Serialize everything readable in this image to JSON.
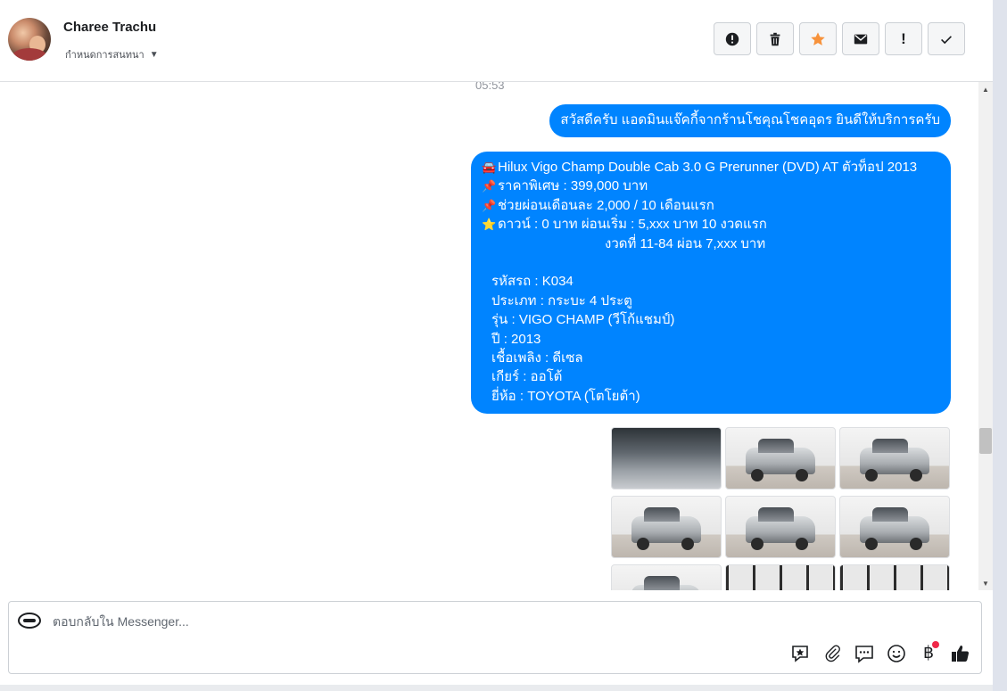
{
  "header": {
    "contact_name": "Charee Trachu",
    "assign_label": "กำหนดการสนทนา",
    "toolbar": [
      {
        "name": "spam-button",
        "icon": "alert-circle-icon"
      },
      {
        "name": "delete-button",
        "icon": "trash-icon"
      },
      {
        "name": "star-button",
        "icon": "star-icon"
      },
      {
        "name": "mark-unread-button",
        "icon": "envelope-icon"
      },
      {
        "name": "follow-up-button",
        "icon": "exclamation-icon"
      },
      {
        "name": "mark-done-button",
        "icon": "check-icon"
      }
    ]
  },
  "chat": {
    "timestamp": "05:53",
    "greeting": "สวัสดีครับ แอดมินแจ๊คกี้จากร้านโชคุณโชคอุดร ยินดีให้บริการครับ",
    "details": {
      "title": "Hilux Vigo Champ Double Cab 3.0 G Prerunner (DVD) AT ตัวท็อป  2013",
      "price": "ราคาพิเศษ : 399,000 บาท",
      "installment": "ช่วยผ่อนเดือนละ 2,000 / 10 เดือนแรก",
      "down": "ดาวน์ : 0 บาท ผ่อนเริ่ม : 5,xxx บาท 10 งวดแรก",
      "down_cont": "งวดที่ 11-84 ผ่อน 7,xxx บาท",
      "code": "รหัสรถ : K034",
      "type": "ประเภท : กระบะ 4 ประตู",
      "model": "รุ่น : VIGO CHAMP (วีโก้แชมป์)",
      "year": "ปี : 2013",
      "fuel": "เชื้อเพลิง : ดีเซล",
      "gear": "เกียร์ : ออโต้",
      "brand": "ยี่ห้อ : TOYOTA (โตโยต้า)"
    },
    "photo_count": 9
  },
  "composer": {
    "placeholder": "ตอบกลับใน Messenger..."
  },
  "colors": {
    "bubble": "#0084ff",
    "star": "#f7923b",
    "notification_dot": "#f02849"
  }
}
